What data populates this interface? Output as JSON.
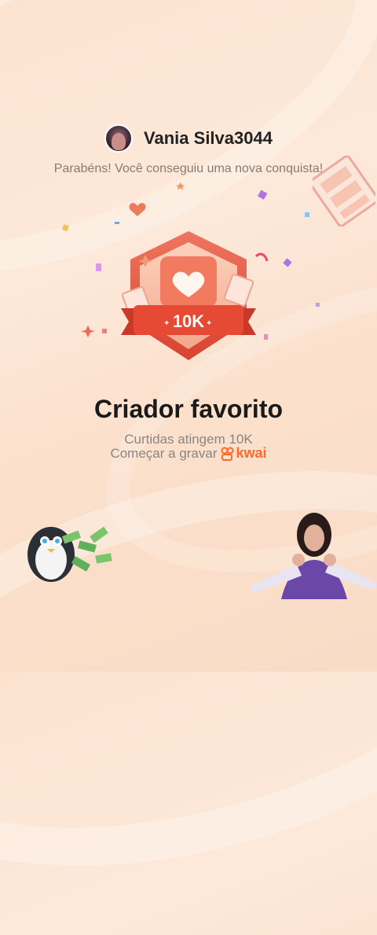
{
  "user": {
    "name": "Vania Silva3044"
  },
  "achievement": {
    "congrats_text": "Parabéns! Você conseguiu uma nova conquista!",
    "badge_label": "10K",
    "title": "Criador favorito",
    "subtitle": "Curtidas atingem 10K",
    "record_prompt": "Começar a gravar",
    "brand": "kwai"
  },
  "colors": {
    "badge_red": "#e2533e",
    "badge_light": "#f7c7b0",
    "brand_orange": "#ff6a2b"
  },
  "icons": [
    "heart-icon",
    "kwai-logo-icon"
  ]
}
